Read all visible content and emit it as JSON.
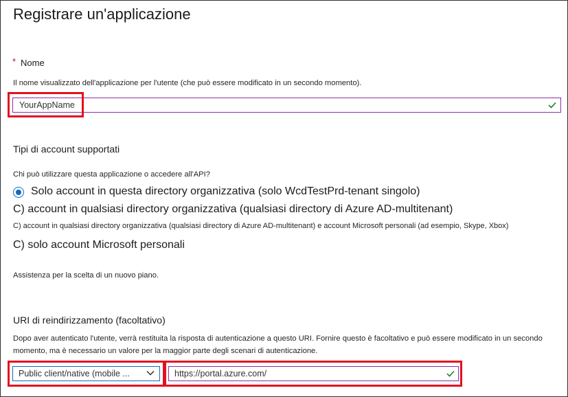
{
  "page": {
    "title": "Registrare un'applicazione"
  },
  "name_section": {
    "required_marker": "*",
    "label": "Nome",
    "help": "Il nome visualizzato dell'applicazione per l'utente (che può essere modificato in un secondo momento).",
    "value": "YourAppName"
  },
  "account_types": {
    "heading": "Tipi di account supportati",
    "question": "Chi può utilizzare questa applicazione o accedere all'API?",
    "options": [
      {
        "label": "Solo account in questa directory organizzativa (solo WcdTestPrd-tenant singolo)",
        "selected": true
      },
      {
        "label": "C) account in qualsiasi directory organizzativa (qualsiasi directory di Azure AD-multitenant)",
        "selected": false
      },
      {
        "label": "C) account in qualsiasi directory organizzativa (qualsiasi directory di Azure AD-multitenant) e account Microsoft personali (ad esempio, Skype, Xbox)",
        "selected": false
      },
      {
        "label": "C) solo account Microsoft personali",
        "selected": false
      }
    ],
    "help_link": "Assistenza per la scelta di un nuovo piano."
  },
  "redirect": {
    "heading": "URI di reindirizzamento (facoltativo)",
    "help_line1": "Dopo aver autenticato l'utente, verrà restituita la risposta di autenticazione a questo URI. Fornire questo è facoltativo e può essere modificato in un secondo",
    "help_line2": "momento, ma è necessario un valore per la maggior parte degli scenari di autenticazione.",
    "platform_selected": "Public client/native (mobile ...",
    "uri_value": "https://portal.azure.com/"
  },
  "colors": {
    "highlight_red": "#e3101f",
    "valid_green": "#107c10",
    "accent_blue": "#0f6cbd",
    "focus_purple": "#8a2da5"
  },
  "icons": {
    "valid": "checkmark-icon",
    "dropdown": "chevron-down-icon",
    "radio": "radio-selected-icon"
  }
}
